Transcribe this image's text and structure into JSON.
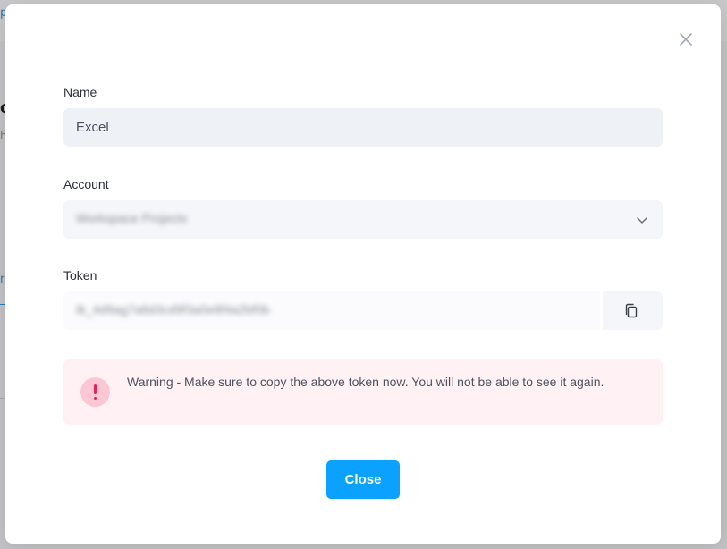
{
  "background": {
    "fragments": [
      {
        "text": "p",
        "color": "#2a7bbd"
      },
      {
        "text": "c",
        "color": "#1b1b1b"
      },
      {
        "text": "h",
        "color": "#7a7a7a"
      },
      {
        "text": "rs",
        "color": "#2a7bbd"
      }
    ]
  },
  "modal": {
    "close_icon": "close-icon",
    "name": {
      "label": "Name",
      "value": "Excel"
    },
    "account": {
      "label": "Account",
      "value_blurred": "Workspace Projects",
      "icon": "chevron-down-icon"
    },
    "token": {
      "label": "Token",
      "value_blurred": "tk_4d9ag7a8d3cd9f3a0e8f4a2bf0b",
      "copy_icon": "copy-icon"
    },
    "warning": {
      "icon": "exclamation-icon",
      "text": "Warning - Make sure to copy the above token now. You will not be able to see it again."
    },
    "close_button_label": "Close"
  },
  "colors": {
    "primary_button": "#0aa1ff",
    "warning_bg": "#fff1f4",
    "warning_icon": "#e0245e"
  }
}
